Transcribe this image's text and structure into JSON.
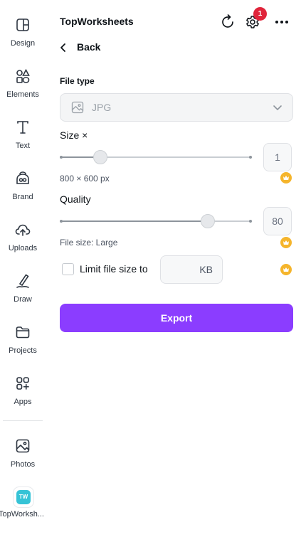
{
  "sidebar": {
    "items": [
      {
        "label": "Design",
        "icon": "design-icon"
      },
      {
        "label": "Elements",
        "icon": "elements-icon"
      },
      {
        "label": "Text",
        "icon": "text-icon"
      },
      {
        "label": "Brand",
        "icon": "brand-icon"
      },
      {
        "label": "Uploads",
        "icon": "uploads-icon"
      },
      {
        "label": "Draw",
        "icon": "draw-icon"
      },
      {
        "label": "Projects",
        "icon": "projects-icon"
      },
      {
        "label": "Apps",
        "icon": "apps-icon"
      },
      {
        "label": "Photos",
        "icon": "photos-icon"
      }
    ],
    "app_tile": {
      "logo_text": "TW",
      "label": "TopWorksh..."
    }
  },
  "header": {
    "title": "TopWorksheets",
    "notification_count": "1",
    "icons": [
      "refresh-icon",
      "gear-icon",
      "more-icon"
    ]
  },
  "back_label": "Back",
  "file_type": {
    "label": "File type",
    "value": "JPG"
  },
  "size": {
    "label": "Size ×",
    "value": "1",
    "fraction": 0.21,
    "dimensions": "800 × 600 px"
  },
  "quality": {
    "label": "Quality",
    "value": "80",
    "fraction": 0.77,
    "file_size": "File size: Large"
  },
  "limit": {
    "label": "Limit file size to",
    "checked": false,
    "value": "",
    "unit": "KB"
  },
  "export_label": "Export",
  "colors": {
    "accent": "#8b3dff",
    "badge": "#e0243a",
    "crown": "#f5b52c",
    "app_logo": "#36c3d6"
  }
}
